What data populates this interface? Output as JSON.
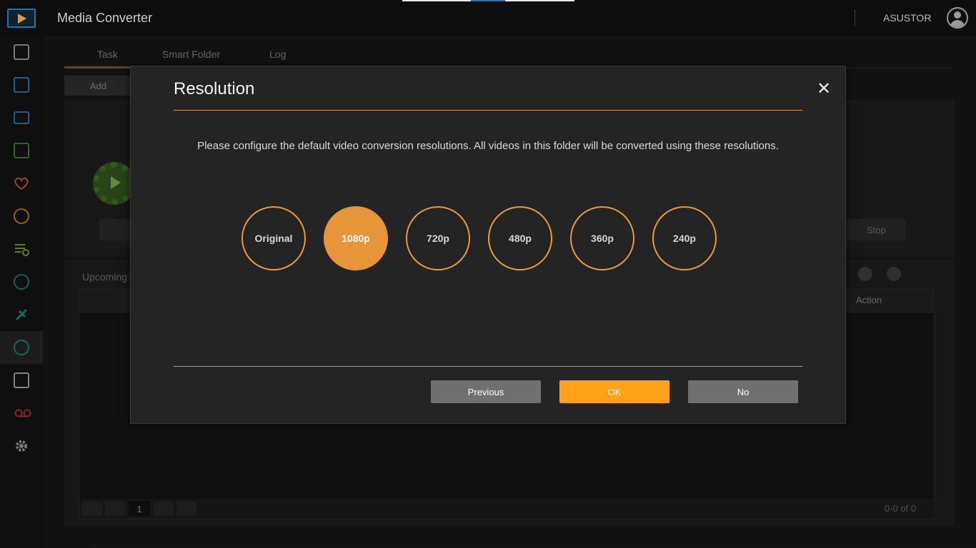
{
  "app": {
    "title": "Media Converter",
    "user": "ASUSTOR"
  },
  "sidebar": {
    "items": [
      {
        "icon": "printer-icon",
        "color": "#b8b8b8"
      },
      {
        "icon": "film-icon",
        "color": "#2f8fd0"
      },
      {
        "icon": "tv-icon",
        "color": "#2f8fd0"
      },
      {
        "icon": "media-folder-icon",
        "color": "#3fa13a"
      },
      {
        "icon": "heart-icon",
        "color": "#e07a2e"
      },
      {
        "icon": "clock-icon",
        "color": "#d8a21a"
      },
      {
        "icon": "playlist-icon",
        "color": "#9bbf2a"
      },
      {
        "icon": "sync-icon",
        "color": "#1f8fa0"
      },
      {
        "icon": "satellite-icon",
        "color": "#1fa08f"
      },
      {
        "icon": "media-converter-icon",
        "color": "#1fa08f"
      },
      {
        "icon": "video-folder-icon",
        "color": "#c8c8c8"
      },
      {
        "icon": "voicemail-icon",
        "color": "#d03a3a"
      },
      {
        "icon": "gear-icon",
        "color": "#bbbbbb"
      }
    ]
  },
  "background": {
    "tabs": [
      "Task",
      "Smart Folder",
      "Log"
    ],
    "add_label": "Add",
    "stop_label": "Stop",
    "upcoming_label": "Upcoming",
    "action_header": "Action",
    "page_number": "1",
    "count": "0-0 of 0"
  },
  "modal": {
    "title": "Resolution",
    "close_symbol": "✕",
    "description": "Please configure the default video conversion resolutions. All videos in this folder will be converted using these resolutions.",
    "resolutions": [
      {
        "label": "Original",
        "selected": false
      },
      {
        "label": "1080p",
        "selected": true
      },
      {
        "label": "720p",
        "selected": false
      },
      {
        "label": "480p",
        "selected": false
      },
      {
        "label": "360p",
        "selected": false
      },
      {
        "label": "240p",
        "selected": false
      }
    ],
    "buttons": {
      "previous": "Previous",
      "ok": "OK",
      "no": "No"
    },
    "accent": "#e8953a",
    "ok_color": "#ffa21a"
  }
}
